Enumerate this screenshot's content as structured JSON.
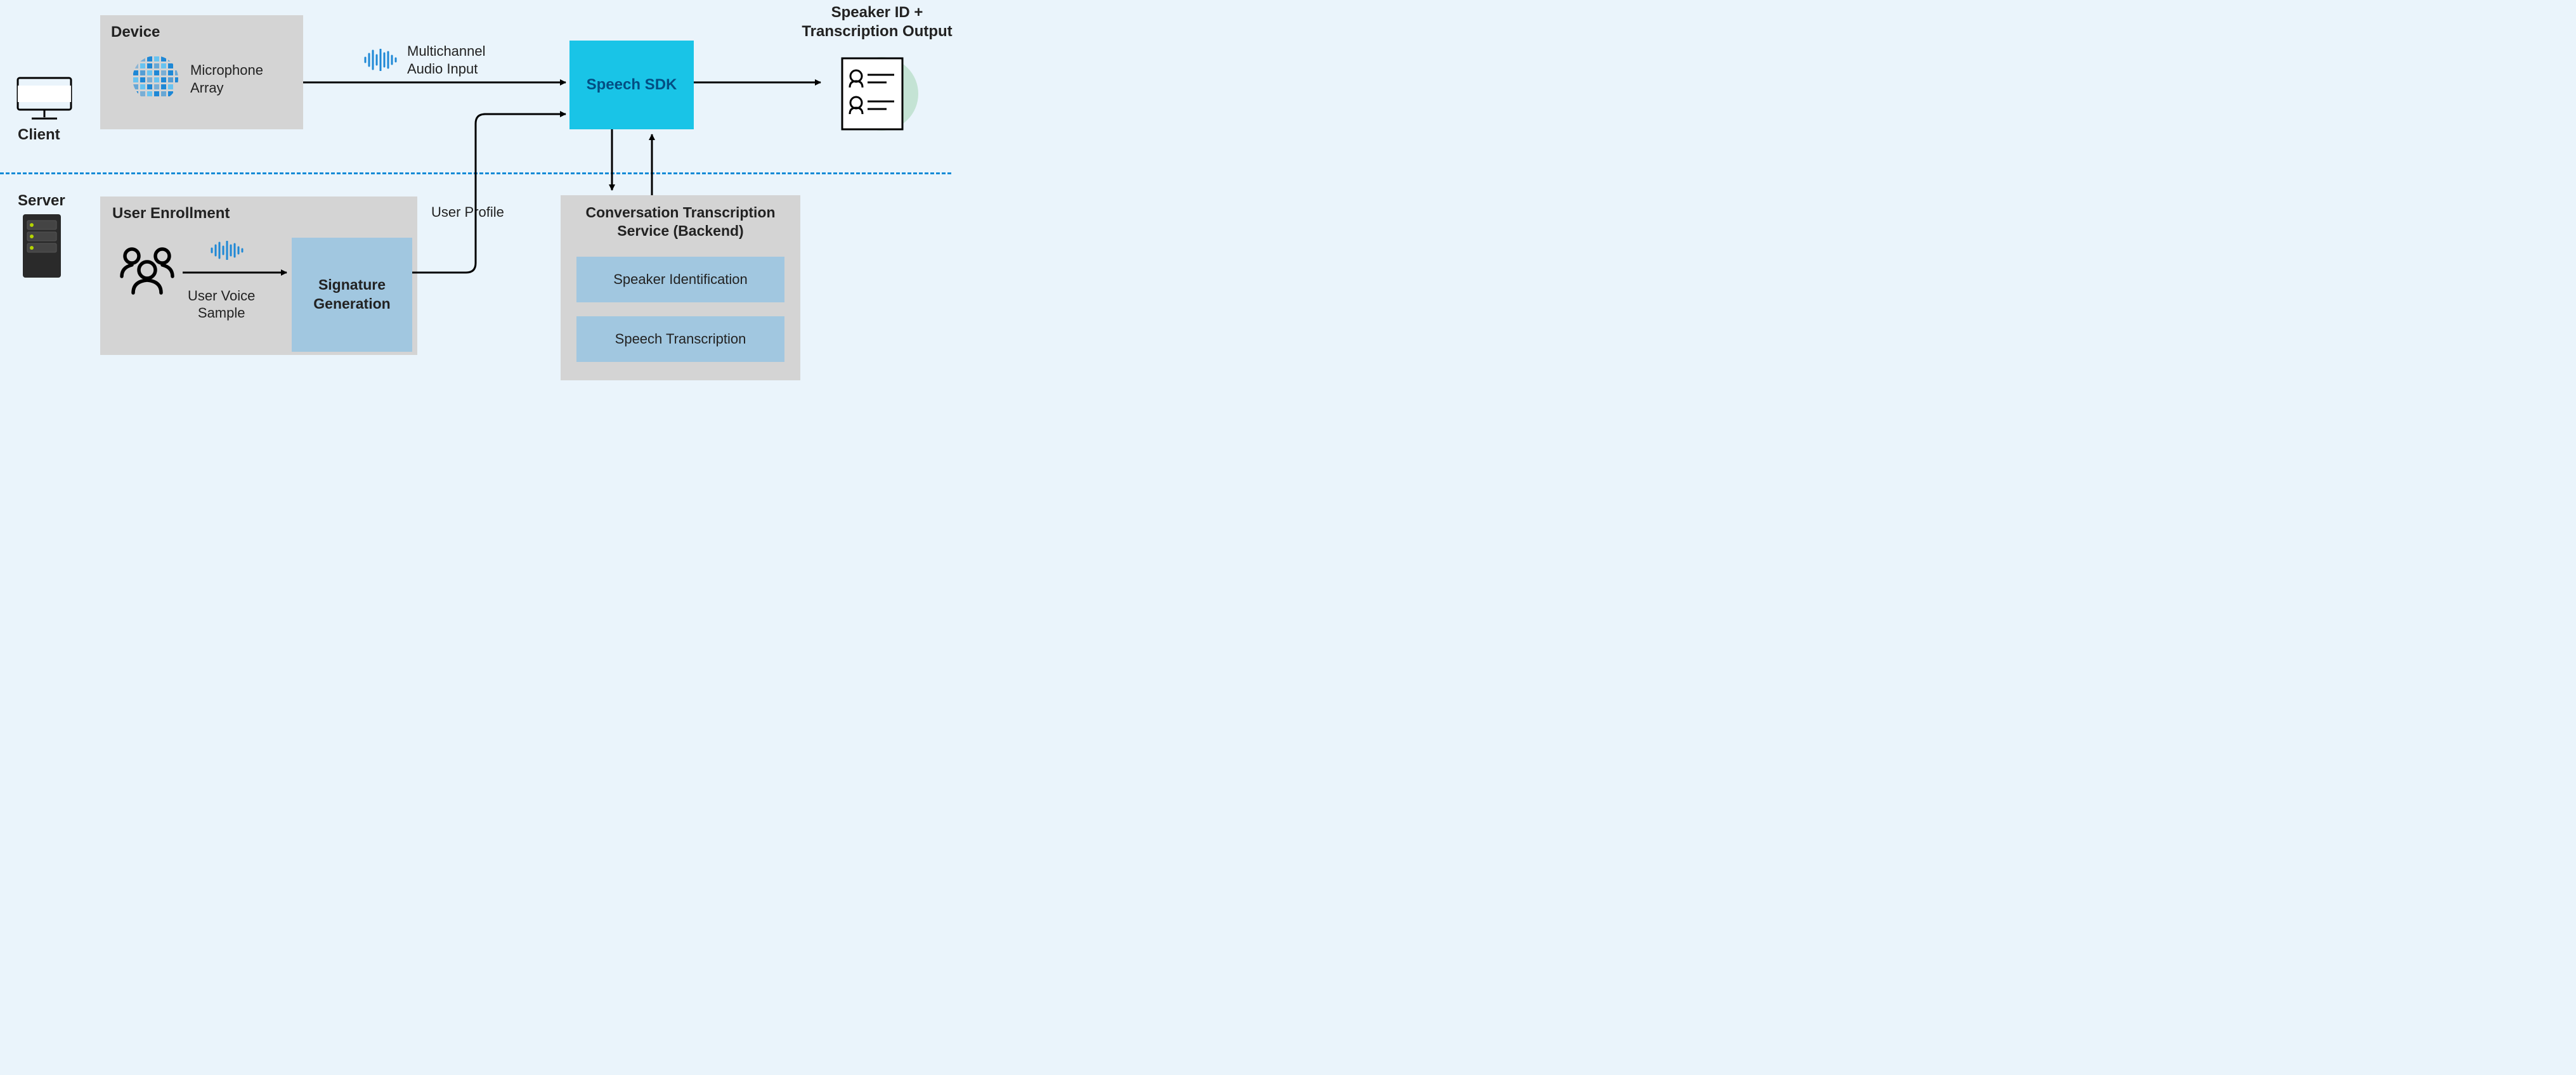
{
  "sections": {
    "client": "Client",
    "server": "Server"
  },
  "nodes": {
    "device_title": "Device",
    "mic_array": "Microphone\nArray",
    "speech_sdk": "Speech SDK",
    "output_title": "Speaker ID +\nTranscription Output",
    "user_enrollment_title": "User Enrollment",
    "signature_gen": "Signature\nGeneration",
    "backend_title": "Conversation Transcription\nService (Backend)",
    "backend_item1": "Speaker Identification",
    "backend_item2": "Speech Transcription"
  },
  "edge_labels": {
    "audio_input": "Multichannel\nAudio Input",
    "user_profile": "User Profile",
    "voice_sample": "User Voice\nSample"
  }
}
